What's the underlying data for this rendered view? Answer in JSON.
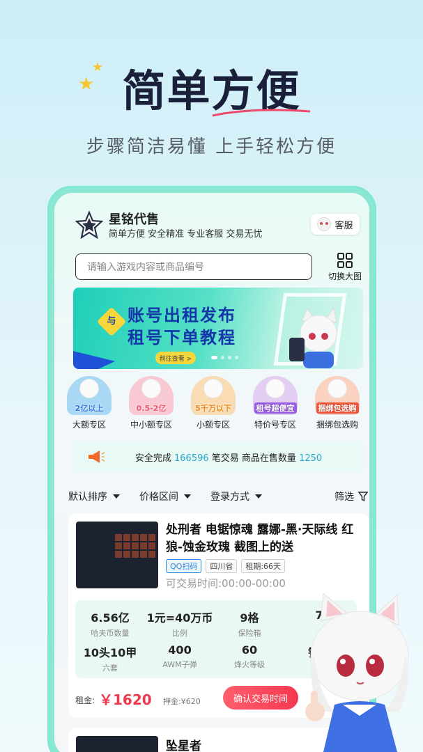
{
  "hero": {
    "headline": "简单方便",
    "subhead": "步骤简洁易懂  上手轻松方便"
  },
  "app": {
    "name": "星铭代售",
    "slogan": "简单方便 安全精准 专业客服 交易无忧",
    "cs_label": "客服",
    "search_placeholder": "请输入游戏内容或商品编号",
    "view_toggle_label": "切换大图"
  },
  "banner": {
    "badge": "与",
    "line1": "账号出租发布",
    "line2": "租号下单教程",
    "cta": "前往查看 >"
  },
  "categories": [
    {
      "tag": "2亿以上",
      "label": "大额专区",
      "color": "#a9d8f4"
    },
    {
      "tag": "0.5-2亿",
      "label": "中小额专区",
      "color": "#f8c9d3"
    },
    {
      "tag": "5千万以下",
      "label": "小额专区",
      "color": "#f9dcb4"
    },
    {
      "tag": "租号超便宜",
      "label": "特价号专区",
      "color": "#e3cdf3"
    },
    {
      "tag": "捆绑包选购",
      "label": "捆绑包选购",
      "color": "#fbd2bf"
    }
  ],
  "stats": {
    "prefix": "安全完成",
    "trades": "166596",
    "middle": "笔交易 商品在售数量",
    "on_sale": "1250"
  },
  "filters": {
    "sort": "默认排序",
    "price": "价格区间",
    "login": "登录方式",
    "screen": "筛选"
  },
  "listing1": {
    "title": "处刑者 电锯惊魂 露娜-黑·天际线 红狼-蚀金玫瑰 截图上的送",
    "tags": [
      "QQ扫码",
      "四川省",
      "租期:66天"
    ],
    "trade_time": "可交易时间:00:00-00:00",
    "specs": [
      {
        "value": "6.56亿",
        "key": "哈夫币数量"
      },
      {
        "value": "1元=40万币",
        "key": "比例"
      },
      {
        "value": "9格",
        "key": "保险箱"
      },
      {
        "value": "7",
        "key": ""
      },
      {
        "value": "10头10甲",
        "key": "六套"
      },
      {
        "value": "400",
        "key": "AWM子弹"
      },
      {
        "value": "60",
        "key": "烽火等级"
      },
      {
        "value": "钻石",
        "key": "段"
      }
    ],
    "rent_label": "租金:",
    "rent_price": "￥1620",
    "deposit": "押金:¥620",
    "confirm": "确认交易时间"
  },
  "listing2": {
    "title": "坠星者"
  },
  "colors": {
    "accent_teal": "#7ee8d4",
    "price_red": "#f0384e",
    "link_blue": "#25a7c9"
  }
}
